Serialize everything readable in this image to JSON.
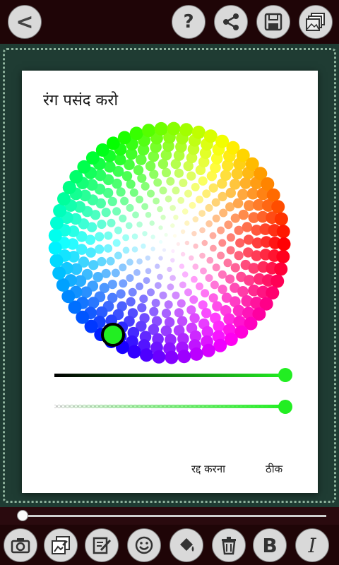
{
  "dialog": {
    "title": "रंग पसंद करो",
    "cancel_label": "रद्द करना",
    "ok_label": "ठीक"
  },
  "color_picker": {
    "selected_color": "#22ee22",
    "value_slider_level": 1.0,
    "opacity_slider_level": 1.0
  },
  "top_toolbar": {
    "icons": [
      "back-icon",
      "help-icon",
      "share-icon",
      "save-icon",
      "gallery-icon"
    ],
    "back_label": "<",
    "help_label": "?"
  },
  "bottom_toolbar": {
    "icons": [
      "camera-icon",
      "image-upload-icon",
      "edit-icon",
      "smiley-icon",
      "paint-bucket-icon",
      "trash-icon",
      "bold-icon",
      "italic-icon"
    ],
    "bold_label": "B",
    "italic_label": "I"
  },
  "colors": {
    "top_bar": "#1f0507",
    "canvas_background": "#1f3c33",
    "accent_green": "#22ee22"
  }
}
